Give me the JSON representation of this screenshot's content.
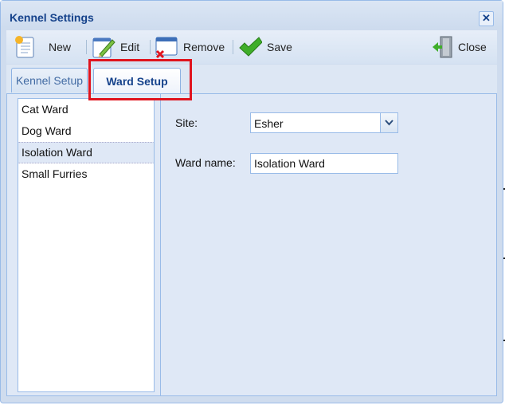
{
  "window": {
    "title": "Kennel Settings"
  },
  "toolbar": {
    "new_label": "New",
    "edit_label": "Edit",
    "remove_label": "Remove",
    "save_label": "Save",
    "close_label": "Close"
  },
  "tabs": [
    {
      "label": "Kennel Setup",
      "active": false
    },
    {
      "label": "Ward Setup",
      "active": true
    }
  ],
  "wards": [
    "Cat Ward",
    "Dog Ward",
    "Isolation Ward",
    "Small Furries"
  ],
  "selected_ward": "Isolation Ward",
  "form": {
    "site_label": "Site:",
    "site_value": "Esher",
    "ward_name_label": "Ward name:",
    "ward_name_value": "Isolation Ward"
  },
  "colors": {
    "title_text": "#15428b",
    "window_border": "#99bbe8",
    "highlight_box": "#e0141e"
  },
  "icons": [
    "new-document-icon",
    "edit-pencil-icon",
    "remove-icon",
    "save-checkmark-icon",
    "exit-door-icon",
    "close-icon",
    "chevron-down-icon"
  ]
}
